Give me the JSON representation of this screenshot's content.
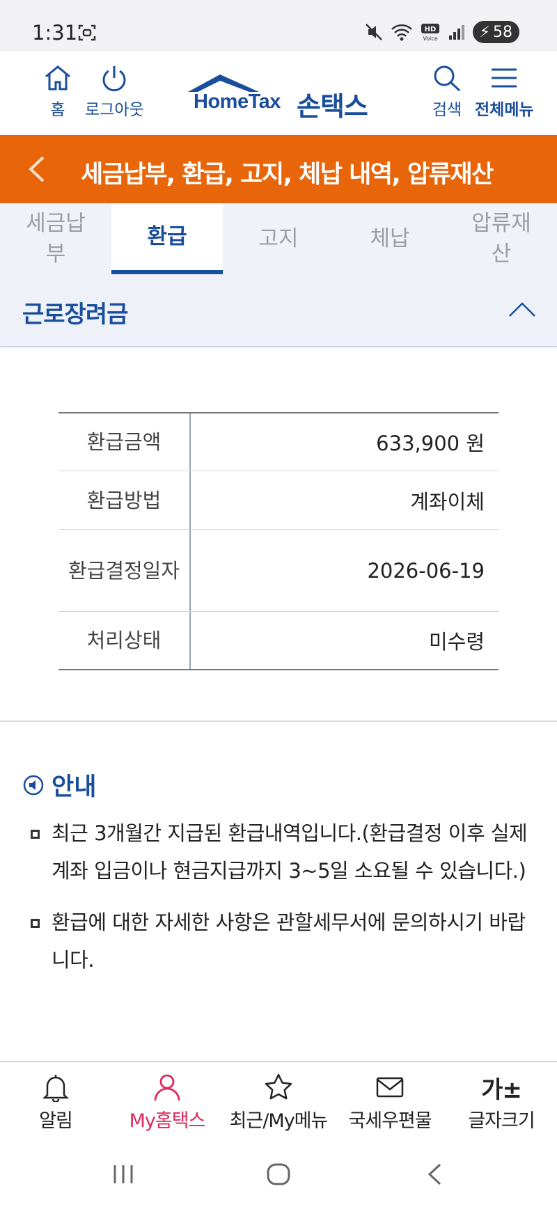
{
  "status_bar": {
    "time": "1:31",
    "battery": "58"
  },
  "header": {
    "home_label": "홈",
    "logout_label": "로그아웃",
    "logo_text": "HomeTax",
    "logo_kor": "손택스",
    "search_label": "검색",
    "menu_label": "전체메뉴",
    "brand_color": "#1a4e9c"
  },
  "title_bar": {
    "title": "세금납부, 환급, 고지, 체납 내역, 압류재산",
    "color": "#e8650a"
  },
  "tabs": [
    {
      "label": "세금납부"
    },
    {
      "label": "환급"
    },
    {
      "label": "고지"
    },
    {
      "label": "체납"
    },
    {
      "label": "압류재산"
    }
  ],
  "active_tab": "환급",
  "section": {
    "title": "근로장려금"
  },
  "refund_table": [
    {
      "label": "환급금액",
      "value": "633,900 원"
    },
    {
      "label": "환급방법",
      "value": "계좌이체"
    },
    {
      "label": "환급결정일자",
      "value": "2026-06-19"
    },
    {
      "label": "처리상태",
      "value": "미수령"
    }
  ],
  "guide": {
    "title": "안내",
    "items": [
      "최근 3개월간 지급된 환급내역입니다.(환급결정 이후 실제 계좌 입금이나 현금지급까지 3~5일 소요될 수 있습니다.)",
      "환급에 대한 자세한 사항은 관할세무서에 문의하시기 바랍니다."
    ]
  },
  "bottom_nav": [
    {
      "label": "알림",
      "icon": "bell-icon"
    },
    {
      "label": "My홈택스",
      "icon": "person-icon",
      "active": true
    },
    {
      "label": "최근/My메뉴",
      "icon": "star-icon"
    },
    {
      "label": "국세우편물",
      "icon": "mail-icon"
    },
    {
      "label": "글자크기",
      "icon": "font-size-icon",
      "glyph": "가±"
    }
  ],
  "active_nav_color": "#e0275a"
}
